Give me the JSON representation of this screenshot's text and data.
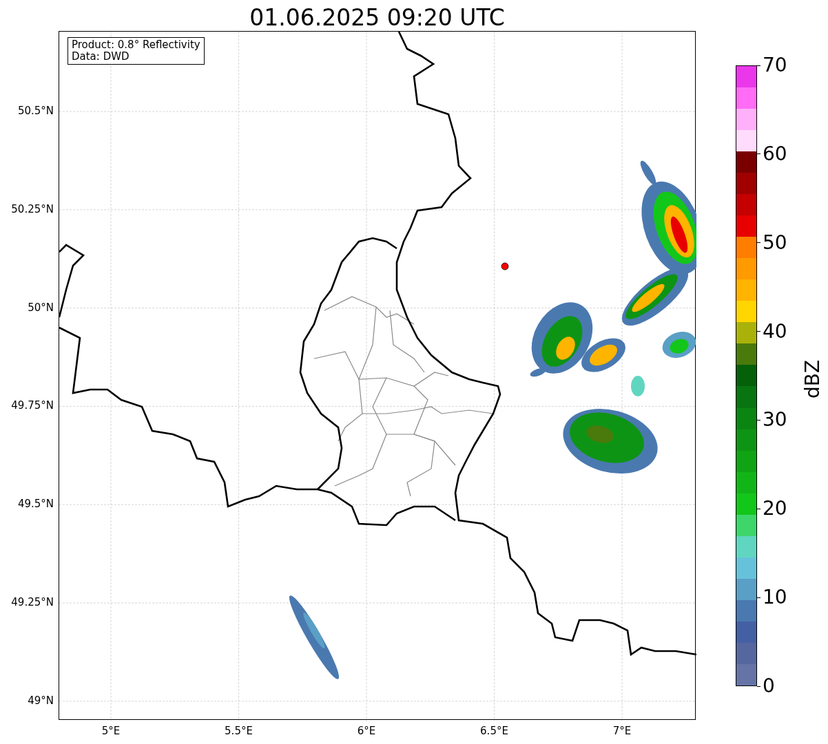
{
  "title": "01.06.2025 09:20 UTC",
  "info_box": [
    "Product: 0.8° Reflectivity",
    "Data: DWD"
  ],
  "lat_ticks": [
    "50.5°N",
    "50.25°N",
    "50°N",
    "49.75°N",
    "49.5°N",
    "49.25°N",
    "49°N"
  ],
  "lon_ticks": [
    "5°E",
    "5.5°E",
    "6°E",
    "6.5°E",
    "7°E"
  ],
  "colorbar": {
    "label": "dBZ",
    "ticks": [
      "70",
      "60",
      "50",
      "40",
      "30",
      "20",
      "10",
      "0"
    ],
    "segments": [
      {
        "color": "#ea37ea"
      },
      {
        "color": "#ff6cf6"
      },
      {
        "color": "#ffb0fa"
      },
      {
        "color": "#ffdcfc"
      },
      {
        "color": "#7a0000"
      },
      {
        "color": "#a00000"
      },
      {
        "color": "#c40000"
      },
      {
        "color": "#e80000"
      },
      {
        "color": "#ff7e00"
      },
      {
        "color": "#ff9a00"
      },
      {
        "color": "#ffb400"
      },
      {
        "color": "#ffd600"
      },
      {
        "color": "#aab20a"
      },
      {
        "color": "#4a7a0c"
      },
      {
        "color": "#05600a"
      },
      {
        "color": "#087510"
      },
      {
        "color": "#0b8512"
      },
      {
        "color": "#0e9414"
      },
      {
        "color": "#10a314"
      },
      {
        "color": "#12b518"
      },
      {
        "color": "#13c61a"
      },
      {
        "color": "#3ed66a"
      },
      {
        "color": "#60d6c0"
      },
      {
        "color": "#66c2da"
      },
      {
        "color": "#5a9fc6"
      },
      {
        "color": "#4a79b0"
      },
      {
        "color": "#4460a4"
      },
      {
        "color": "#55679e"
      },
      {
        "color": "#6673a6"
      }
    ]
  }
}
